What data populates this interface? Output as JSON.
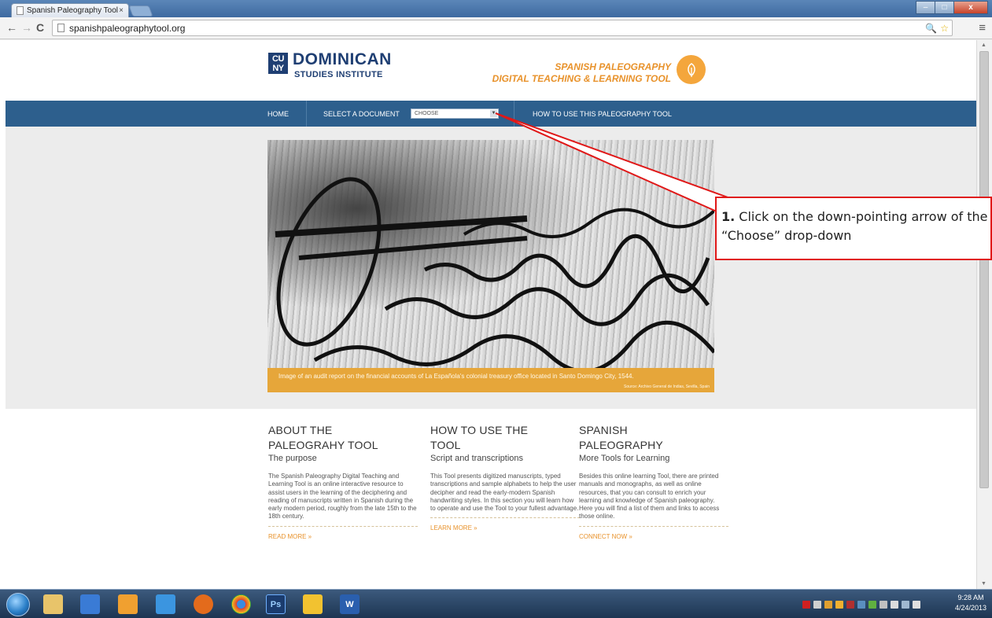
{
  "browser": {
    "tab_title": "Spanish Paleography Tool",
    "tab_close": "×",
    "url": "spanishpaleographytool.org",
    "nav_back": "←",
    "nav_forward": "→",
    "nav_reload": "C",
    "menu": "≡",
    "zoom_icon": "🔍",
    "star_icon": "☆",
    "window_min": "–",
    "window_max": "□",
    "window_close": "x"
  },
  "header": {
    "cuny_logo": "CU NY",
    "institute_main": "DOMINICAN",
    "institute_sub": "STUDIES INSTITUTE",
    "tool_line1": "SPANISH PALEOGRAPHY",
    "tool_line2": "DIGITAL TEACHING & LEARNING TOOL"
  },
  "nav": {
    "home": "HOME",
    "select_document": "SELECT A DOCUMENT",
    "select_value": "CHOOSE",
    "how_to": "HOW TO USE THIS PALEOGRAPHY TOOL"
  },
  "hero": {
    "caption": "Image of an audit report on the financial accounts of La Española's colonial treasury office located in Santo Domingo City, 1544.",
    "source": "Source: Archivo General de Indias, Sevilla, Spain"
  },
  "columns": [
    {
      "title_line1": "ABOUT THE",
      "title_line2": "PALEOGRAHY TOOL",
      "subtitle": "The purpose",
      "body": "The Spanish Paleography Digital Teaching and Learning Tool is an online interactive resource to assist users in the learning of the deciphering and reading of manuscripts written in Spanish during the early modern period, roughly from the late 15th to the 18th century.",
      "link": "READ MORE »"
    },
    {
      "title_line1": "HOW TO USE THE",
      "title_line2": "TOOL",
      "subtitle": "Script and transcriptions",
      "body": "This Tool presents digitized manuscripts, typed transcriptions and sample alphabets to help the user decipher and read the early-modern Spanish handwriting styles. In this section you will learn how to operate and use the Tool to your fullest advantage.",
      "link": "LEARN MORE »"
    },
    {
      "title_line1": "SPANISH",
      "title_line2": "PALEOGRAPHY",
      "subtitle": "More Tools for Learning",
      "body": "Besides this online learning Tool, there are printed manuals and monographs, as well as online resources, that you can consult to enrich your learning and knowledge of Spanish paleography. Here you will find a list of them and links to access those online.",
      "link": "CONNECT NOW »"
    }
  ],
  "callout": {
    "number": "1.",
    "text": " Click on the down-pointing arrow of the “Choose” drop-down"
  },
  "taskbar": {
    "apps": [
      "ie",
      "explorer",
      "media",
      "outlook",
      "ie-alt",
      "firefox",
      "chrome",
      "photoshop",
      "security",
      "word"
    ],
    "photoshop_label": "Ps",
    "word_label": "W",
    "clock_time": "9:28 AM",
    "clock_date": "4/24/2013"
  },
  "colors": {
    "nav_blue": "#2d5f8d",
    "brand_orange": "#e8922b",
    "callout_red": "#e01818"
  }
}
